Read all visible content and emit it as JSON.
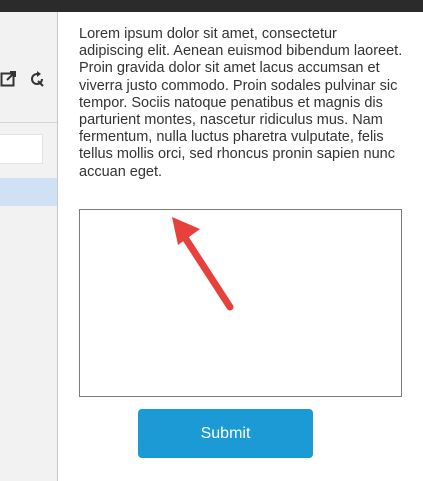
{
  "left_panel": {
    "toolbar_icons": [
      "open-external-icon",
      "refresh-icon"
    ],
    "filter_input": {
      "value": "",
      "placeholder": ""
    }
  },
  "main": {
    "paragraph": "Lorem ipsum dolor sit amet, consectetur adipiscing elit. Aenean euismod bibendum laoreet. Proin gravida dolor sit amet lacus accumsan et viverra justo commodo. Proin sodales pulvinar sic tempor. Sociis natoque penatibus et magnis dis parturient montes, nascetur ridiculus mus. Nam fermentum, nulla luctus pharetra vulputate, felis tellus mollis orci, sed rhoncus pronin sapien nunc accuan eget.",
    "textarea": {
      "value": "",
      "placeholder": ""
    },
    "submit_label": "Submit"
  },
  "annotation": {
    "arrow_color": "#e8413c"
  },
  "colors": {
    "topbar": "#2b2b2b",
    "panel": "#f2f2f2",
    "selected_row": "#cfe1f3",
    "button": "#1b9ad6"
  }
}
